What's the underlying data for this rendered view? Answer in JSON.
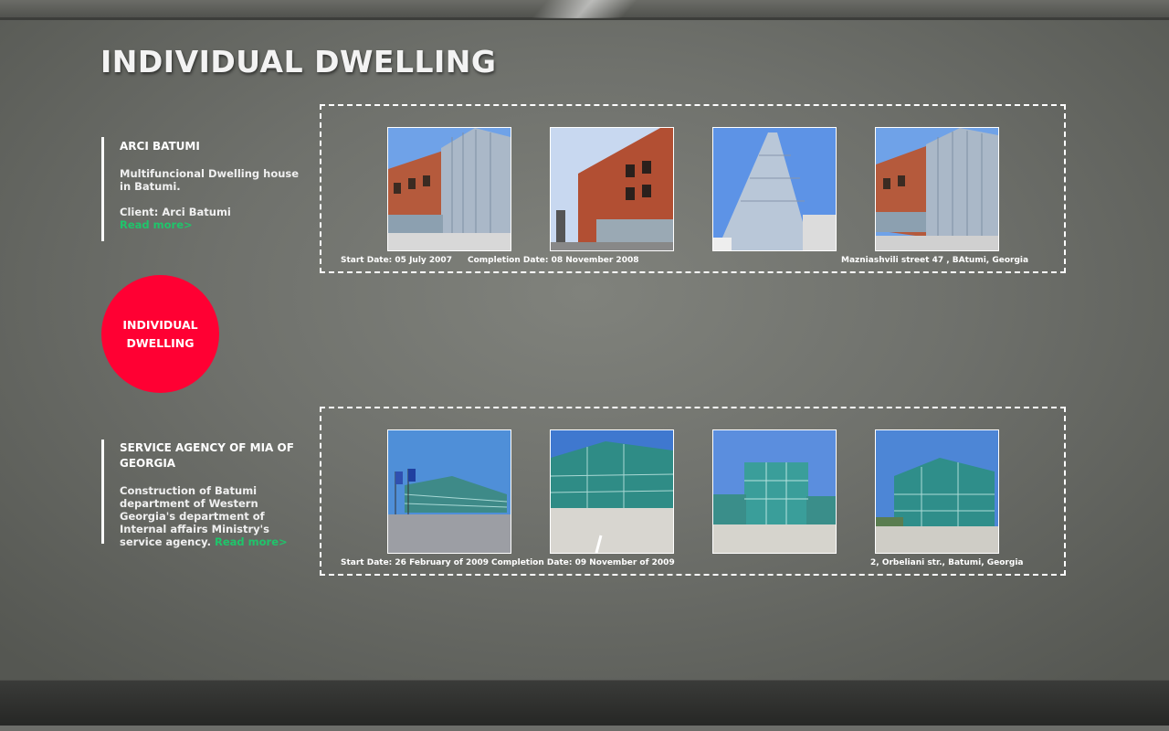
{
  "page": {
    "title": "INDIVIDUAL DWELLING"
  },
  "category_badge": {
    "label": "INDIVIDUAL DWELLING",
    "color": "#ff0033"
  },
  "projects": [
    {
      "title": "ARCI BATUMI",
      "description": "Multifuncional Dwelling house in Batumi.",
      "client": "Client: Arci Batumi",
      "read_more": "Read more>",
      "start_date": "Start Date: 05 July 2007",
      "completion_date": "Completion Date: 08 November 2008",
      "address": "Mazniashvili street 47 , BAtumi, Georgia",
      "photos": [
        "brick-glass-building-photo",
        "brick-building-street-photo",
        "glass-facade-photo",
        "brick-glass-building-photo"
      ]
    },
    {
      "title": "SERVICE AGENCY OF MIA OF GEORGIA",
      "description": "Construction of Batumi department of Western Georgia's department of Internal affairs Ministry's service agency.",
      "read_more": "Read more>",
      "start_date": "Start Date: 26 February of 2009",
      "completion_date": "Completion Date: 09 November  of 2009",
      "address": "2, Orbeliani str., Batumi, Georgia",
      "photos": [
        "glass-building-flags-photo",
        "glass-building-corner-photo",
        "glass-building-front-photo",
        "glass-building-side-photo"
      ]
    }
  ],
  "colors": {
    "accent_red": "#ff0033",
    "link_green": "#1fc56b",
    "background": "#70726d"
  }
}
